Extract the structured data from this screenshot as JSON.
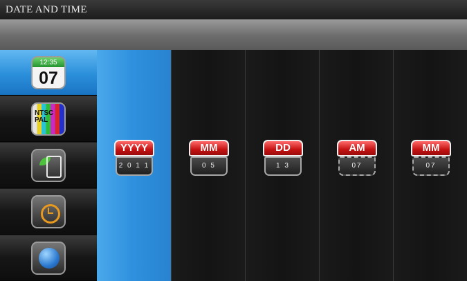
{
  "header": {
    "title": "DATE AND TIME"
  },
  "sidebar": {
    "items": [
      {
        "name": "date-time",
        "icon": "calendar-clock-icon",
        "top_text": "12:35",
        "main_text": "07"
      },
      {
        "name": "video-standard",
        "icon": "tv-test-pattern-icon",
        "text_line1": "NTSC",
        "text_line2": "PAL"
      },
      {
        "name": "eco-mode",
        "icon": "leaf-document-icon"
      },
      {
        "name": "timer",
        "icon": "clock-icon"
      },
      {
        "name": "language",
        "icon": "globe-icon"
      }
    ]
  },
  "spinners": [
    {
      "label": "YYYY",
      "value": "2 0 1 1"
    },
    {
      "label": "MM",
      "value": "0 5"
    },
    {
      "label": "DD",
      "value": "1 3"
    },
    {
      "label": "AM",
      "value": "07"
    },
    {
      "label": "MM",
      "value": "07"
    }
  ],
  "colors": {
    "accent": "#2e90de",
    "label_red": "#c61212"
  }
}
